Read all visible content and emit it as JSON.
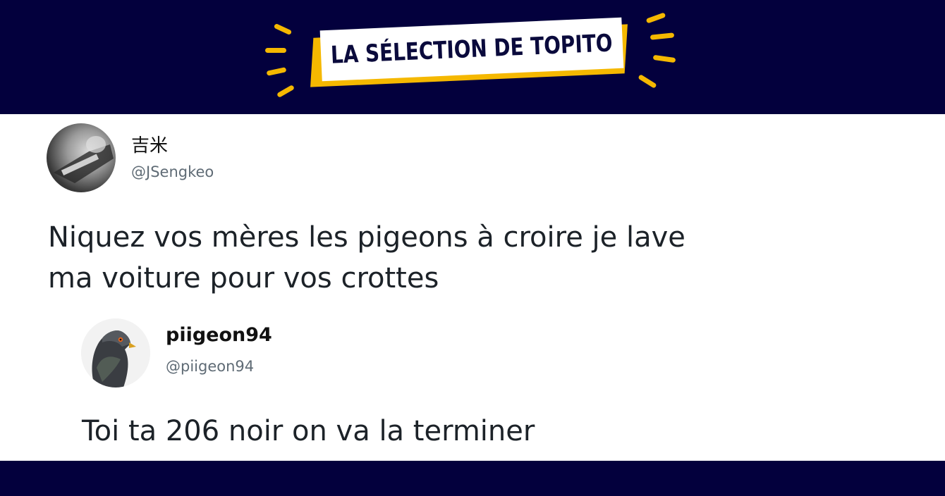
{
  "header": {
    "banner_label": "LA SÉLECTION DE TOPITO"
  },
  "colors": {
    "navy": "#03003d",
    "accent_yellow": "#f5b800",
    "text_dark": "#1c2228",
    "text_muted": "#5f6b75"
  },
  "tweet": {
    "author_name": "吉米",
    "author_handle": "@JSengkeo",
    "text_line1": "Niquez vos mères les pigeons à croire je lave",
    "text_line2": "ma voiture pour vos crottes"
  },
  "reply": {
    "author_name": "piigeon94",
    "author_handle": "@piigeon94",
    "text": "Toi ta 206 noir on va la terminer"
  }
}
